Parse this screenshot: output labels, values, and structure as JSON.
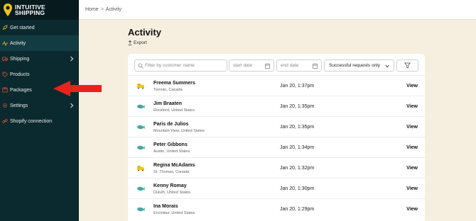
{
  "brand": {
    "line1": "INTUITIVE",
    "line2": "SHIPPING"
  },
  "sidebar": {
    "items": [
      {
        "label": "Get started",
        "icon": "rocket-icon",
        "active": false,
        "chevron": false
      },
      {
        "label": "Activity",
        "icon": "activity-icon",
        "active": true,
        "chevron": false
      },
      {
        "label": "Shipping",
        "icon": "truck-icon",
        "active": false,
        "chevron": true
      },
      {
        "label": "Products",
        "icon": "tag-icon",
        "active": false,
        "chevron": false
      },
      {
        "label": "Packages",
        "icon": "box-icon",
        "active": false,
        "chevron": false
      },
      {
        "label": "Settings",
        "icon": "gear-icon",
        "active": false,
        "chevron": true
      },
      {
        "label": "Shopify connection",
        "icon": "link-icon",
        "active": false,
        "chevron": false
      }
    ]
  },
  "breadcrumb": {
    "home": "Home",
    "separator": ">",
    "current": "Activity"
  },
  "page": {
    "title": "Activity",
    "export_label": "Export"
  },
  "filters": {
    "search_placeholder": "Filter by customer name",
    "start_placeholder": "start date",
    "end_placeholder": "end date",
    "status_selected": "Successful requests only"
  },
  "rows": [
    {
      "icon": "ups-truck-icon",
      "name": "Freema Summers",
      "location": "Toronto, Canada",
      "date": "Jan 20, 1:37pm",
      "action": "View"
    },
    {
      "icon": "whale-icon",
      "name": "Jim Braaten",
      "location": "Rockford, United States",
      "date": "Jan 20, 1:35pm",
      "action": "View"
    },
    {
      "icon": "whale-icon",
      "name": "Paris de Julios",
      "location": "Mountain View, United States",
      "date": "Jan 20, 1:35pm",
      "action": "View"
    },
    {
      "icon": "whale-icon",
      "name": "Peter Gibbons",
      "location": "Austin, United States",
      "date": "Jan 20, 1:34pm",
      "action": "View"
    },
    {
      "icon": "ups-truck-icon",
      "name": "Regina McAdams",
      "location": "St. Thomas, Canada",
      "date": "Jan 20, 1:32pm",
      "action": "View"
    },
    {
      "icon": "whale-icon",
      "name": "Kenny Romay",
      "location": "Duluth, United States",
      "date": "Jan 20, 1:30pm",
      "action": "View"
    },
    {
      "icon": "whale-icon",
      "name": "Ina Morais",
      "location": "Encinitas, United States",
      "date": "Jan 20, 1:29pm",
      "action": "View"
    }
  ],
  "colors": {
    "sidebar_bg": "#0b2a2f",
    "sidebar_active": "#133c42",
    "page_bg": "#f6efdf",
    "brand_yellow": "#f2c319",
    "arrow_red": "#e8231b",
    "whale_teal": "#4aa7a2",
    "truck_yellow": "#f2c319"
  }
}
